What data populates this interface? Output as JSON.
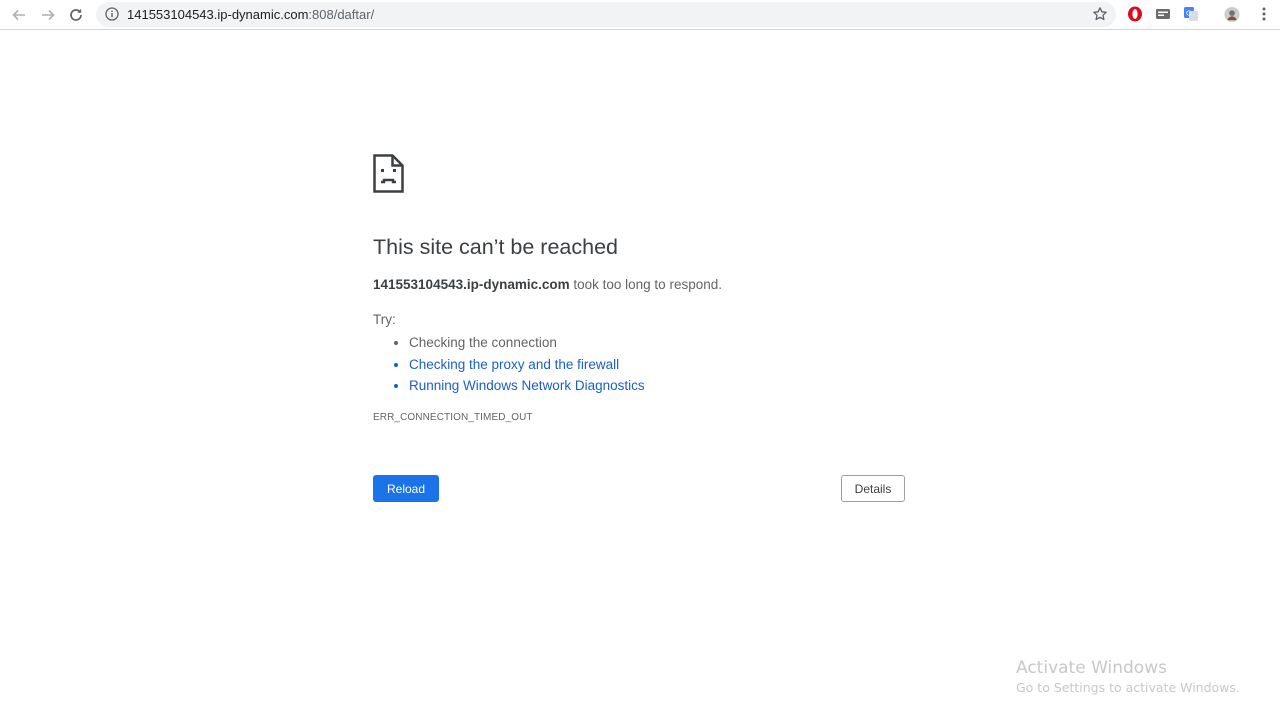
{
  "browser": {
    "url_host": "141553104543.ip-dynamic.com",
    "url_path": ":808/daftar/",
    "icons": {
      "back": "arrow-left-icon",
      "forward": "arrow-right-icon",
      "reload": "reload-icon",
      "site_info": "info-icon",
      "bookmark": "star-icon",
      "menu": "kebab-menu-icon"
    },
    "extensions": [
      "opera-icon",
      "idm-icon",
      "translate-icon",
      "profile-avatar"
    ]
  },
  "error_page": {
    "title": "This site can’t be reached",
    "host": "141553104543.ip-dynamic.com",
    "message": " took too long to respond.",
    "try_label": "Try:",
    "suggestions": [
      "Checking the connection",
      "Checking the proxy and the firewall",
      "Running Windows Network Diagnostics"
    ],
    "error_code": "ERR_CONNECTION_TIMED_OUT",
    "reload_label": "Reload",
    "details_label": "Details"
  },
  "watermark": {
    "title": "Activate Windows",
    "subtitle": "Go to Settings to activate Windows."
  },
  "colors": {
    "accent": "#1a73e8",
    "link": "#1a5fc9",
    "text": "#646464",
    "heading": "#3c4043"
  }
}
